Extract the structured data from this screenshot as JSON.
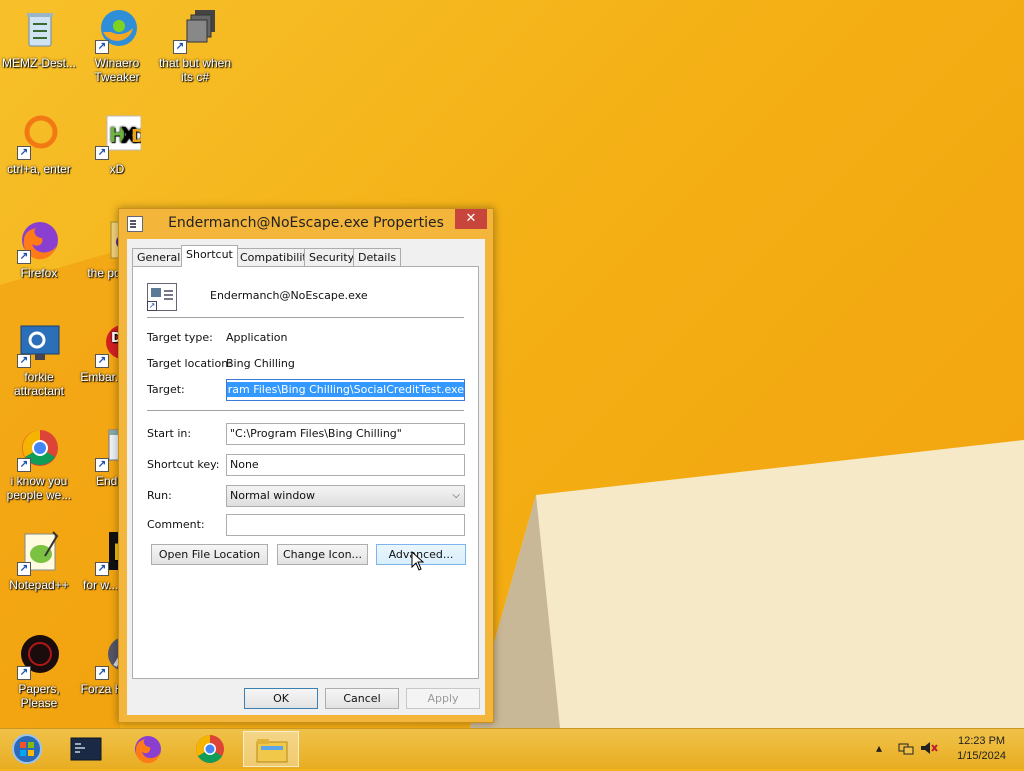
{
  "desktop": {
    "icons": [
      {
        "label": "MEMZ-Dest...",
        "icon": "recycle-bin-icon"
      },
      {
        "label": "Winaero Tweaker",
        "icon": "winaero-icon"
      },
      {
        "label": "that but when its c#",
        "icon": "stack-icon"
      },
      {
        "label": "ctrl+a, enter",
        "icon": "ring-icon"
      },
      {
        "label": "xD",
        "icon": "hxd-icon"
      },
      {
        "label": "Firefox",
        "icon": "firefox-icon"
      },
      {
        "label": "the po... sh",
        "icon": "folder-icon"
      },
      {
        "label": "forkie attractant",
        "icon": "monitor-gear-icon"
      },
      {
        "label": "Embar... Dev-",
        "icon": "red-badge-icon"
      },
      {
        "label": "i know you people we...",
        "icon": "chrome-icon"
      },
      {
        "label": "Enderm",
        "icon": "window-icon"
      },
      {
        "label": "Notepad++",
        "icon": "notepadpp-icon"
      },
      {
        "label": "for w... some",
        "icon": "black-yellow-icon"
      },
      {
        "label": "Papers, Please",
        "icon": "papers-please-icon"
      },
      {
        "label": "Forza H... 5.e",
        "icon": "forza-icon"
      }
    ]
  },
  "dialog": {
    "title": "Endermanch@NoEscape.exe Properties",
    "close_label": "✕",
    "tabs": [
      "General",
      "Shortcut",
      "Compatibility",
      "Security",
      "Details"
    ],
    "active_tab": "Shortcut",
    "file_name": "Endermanch@NoEscape.exe",
    "target_type_label": "Target type:",
    "target_type_value": "Application",
    "target_location_label": "Target location:",
    "target_location_value": "Bing Chilling",
    "target_label": "Target:",
    "target_value": "Program Files\\Bing Chilling\\SocialCreditTest.exe\"",
    "start_in_label": "Start in:",
    "start_in_value": "\"C:\\Program Files\\Bing Chilling\"",
    "shortcut_key_label": "Shortcut key:",
    "shortcut_key_value": "None",
    "run_label": "Run:",
    "run_value": "Normal window",
    "comment_label": "Comment:",
    "comment_value": "",
    "open_file_location": "Open File Location",
    "change_icon": "Change Icon...",
    "advanced": "Advanced...",
    "ok": "OK",
    "cancel": "Cancel",
    "apply": "Apply"
  },
  "taskbar": {
    "items": [
      "start-button",
      "terminal-app",
      "firefox-app",
      "chrome-app",
      "file-explorer-app"
    ],
    "time": "12:23 PM",
    "date": "1/15/2024",
    "tray_icons": [
      "show-hidden-icons",
      "network-icon",
      "volume-muted-icon"
    ]
  },
  "colors": {
    "wallpaper": "#f4b015",
    "dialog_frame": "#f4b63a",
    "close_button": "#c7453a",
    "selection": "#3399ff"
  }
}
